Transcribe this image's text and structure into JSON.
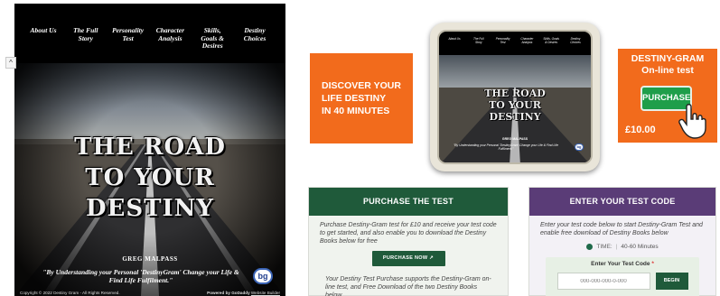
{
  "book_cover": {
    "nav_items": [
      "About Us",
      "The Full\nStory",
      "Personality\nTest",
      "Character\nAnalysis",
      "Skills,\nGoals &\nDesires",
      "Destiny\nChoices"
    ],
    "title": "THE ROAD\nTO YOUR\nDESTINY",
    "author": "GREG MALPASS",
    "quote": "\"By Understanding your Personal 'DestinyGram' Change your Life & Find Life Fulfilment.\"",
    "logo_text": "bg",
    "copyright": "Copyright © 2022 Destiny Gram - All Rights Reserved.",
    "powered_prefix": "Powered by GoDaddy",
    "powered_link": "Website Builder"
  },
  "scroll_up_glyph": "^",
  "discover_box": {
    "text": "DISCOVER YOUR\nLIFE DESTINY\nIN 40 MINUTES"
  },
  "destiny_box": {
    "title": "DESTINY-GRAM\nOn-line test",
    "button_label": "PURCHASE",
    "price": "£10.00"
  },
  "purchase_card": {
    "heading": "PURCHASE THE TEST",
    "description": "Purchase Destiny-Gram test for £10 and receive your test code to get started, and also enable you to download the Destiny Books below for free",
    "button_label": "PURCHASE NOW ↗",
    "note": "Your Destiny Test Purchase supports the Destiny-Gram on-line test, and Free Download of the two Destiny Books below"
  },
  "enter_card": {
    "heading": "ENTER YOUR TEST CODE",
    "description": "Enter your test code below to start Destiny-Gram Test and enable free download of Destiny Books below",
    "time_label": "TIME:",
    "time_value": "40-60 Minutes",
    "code_label": "Enter Your Test Code",
    "code_required": "*",
    "code_placeholder": "000-000-000-0-000",
    "begin_label": "BEGIN"
  },
  "colors": {
    "orange": "#f26b1c",
    "green_dark": "#1f5a3a",
    "purple": "#5a3c77",
    "button_green": "#1f9e4a"
  }
}
